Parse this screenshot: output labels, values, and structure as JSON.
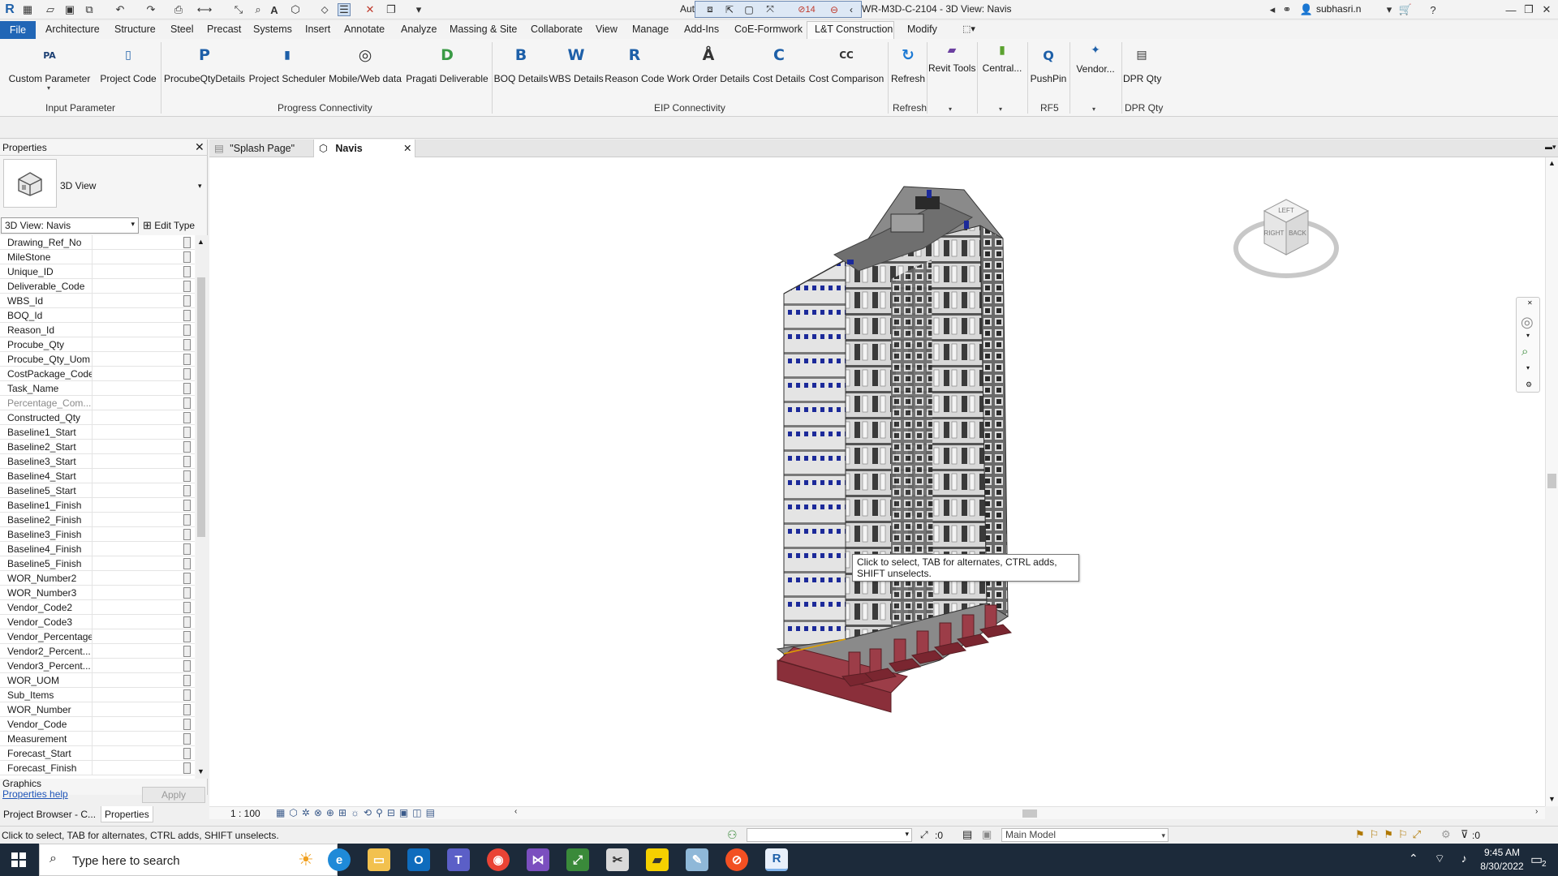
{
  "app": {
    "title": "WR-M3D-C-2104 - 3D View: Navis",
    "title_prefix": "Aut",
    "user": "subhasri.n",
    "warnings_count": "14"
  },
  "menu": {
    "file": "File",
    "items": [
      "Architecture",
      "Structure",
      "Steel",
      "Precast",
      "Systems",
      "Insert",
      "Annotate",
      "Analyze",
      "Massing & Site",
      "Collaborate",
      "View",
      "Manage",
      "Add-Ins",
      "CoE-Formwork",
      "L&T Construction",
      "Modify"
    ],
    "active": "L&T Construction"
  },
  "ribbon": {
    "buttons": [
      {
        "label": "Custom Parameter",
        "icon": "PA"
      },
      {
        "label": "Project Code",
        "icon": "▯"
      },
      {
        "label": "ProcubeQtyDetails",
        "icon": "P"
      },
      {
        "label": "Project Scheduler",
        "icon": "▮"
      },
      {
        "label": "Mobile/Web data",
        "icon": "◎"
      },
      {
        "label": "Pragati Deliverable",
        "icon": "D"
      },
      {
        "label": "BOQ Details",
        "icon": "B"
      },
      {
        "label": "WBS Details",
        "icon": "W"
      },
      {
        "label": "Reason Code",
        "icon": "R"
      },
      {
        "label": "Work Order Details",
        "icon": "Å"
      },
      {
        "label": "Cost Details",
        "icon": "C"
      },
      {
        "label": "Cost Comparison",
        "icon": "CC"
      },
      {
        "label": "Refresh",
        "icon": "↻"
      },
      {
        "label": "Revit Tools",
        "icon": "▰"
      },
      {
        "label": "Central...",
        "icon": "▮"
      },
      {
        "label": "PushPin",
        "icon": "Q"
      },
      {
        "label": "Vendor...",
        "icon": "✦"
      },
      {
        "label": "DPR Qty",
        "icon": "▤"
      }
    ],
    "panels": [
      "Input Parameter",
      "Progress Connectivity",
      "EIP Connectivity",
      "Refresh",
      "RF5",
      "DPR Qty"
    ]
  },
  "properties": {
    "title": "Properties",
    "type_name": "3D View",
    "view_select": "3D View: Navis",
    "edit_type": "Edit Type",
    "params": [
      "Drawing_Ref_No",
      "MileStone",
      "Unique_ID",
      "Deliverable_Code",
      "WBS_Id",
      "BOQ_Id",
      "Reason_Id",
      "Procube_Qty",
      "Procube_Qty_Uom",
      "CostPackage_Code",
      "Task_Name",
      "Percentage_Com...",
      "Constructed_Qty",
      "Baseline1_Start",
      "Baseline2_Start",
      "Baseline3_Start",
      "Baseline4_Start",
      "Baseline5_Start",
      "Baseline1_Finish",
      "Baseline2_Finish",
      "Baseline3_Finish",
      "Baseline4_Finish",
      "Baseline5_Finish",
      "WOR_Number2",
      "WOR_Number3",
      "Vendor_Code2",
      "Vendor_Code3",
      "Vendor_Percentage",
      "Vendor2_Percent...",
      "Vendor3_Percent...",
      "WOR_UOM",
      "Sub_Items",
      "WOR_Number",
      "Vendor_Code",
      "Measurement",
      "Forecast_Start",
      "Forecast_Finish"
    ],
    "graphics": "Graphics",
    "help": "Properties help",
    "apply": "Apply"
  },
  "panel_tabs": [
    "Project Browser - C...",
    "Properties"
  ],
  "view_tabs": [
    {
      "label": "\"Splash Page\""
    },
    {
      "label": "Navis"
    }
  ],
  "viewport": {
    "scale": "1 : 100",
    "tooltip": "Click to select, TAB for alternates, CTRL adds, SHIFT unselects.",
    "viewcube": {
      "top": "LEFT",
      "right_face": "BACK",
      "left_face": "RIGHT"
    }
  },
  "statusbar": {
    "text": "Click to select, TAB for alternates, CTRL adds, SHIFT unselects.",
    "select_count": ":0",
    "model": "Main Model",
    "filter_count": ":0"
  },
  "taskbar": {
    "search_placeholder": "Type here to search",
    "time": "9:45 AM",
    "date": "8/30/2022",
    "notification_count": "2"
  },
  "colors": {
    "accent": "#2166b6",
    "foundation": "#9c3d48",
    "window_blue": "#1c2a9a"
  }
}
